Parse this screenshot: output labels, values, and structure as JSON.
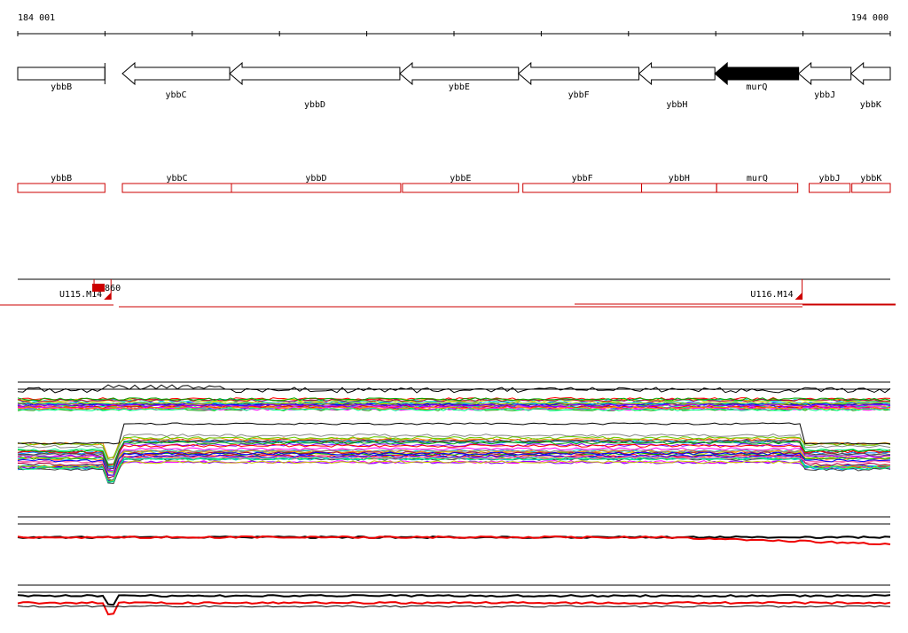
{
  "ruler": {
    "start_label": "184 001",
    "end_label": "194 000"
  },
  "genes": [
    {
      "name": "ybbB",
      "start": 184001,
      "end": 185000,
      "dir": "+",
      "filled": false,
      "label_row": 0
    },
    {
      "name": "ybbC",
      "start": 185200,
      "end": 186430,
      "dir": "-",
      "filled": false,
      "label_row": 1
    },
    {
      "name": "ybbD",
      "start": 186430,
      "end": 188380,
      "dir": "-",
      "filled": false,
      "label_row": 2
    },
    {
      "name": "ybbE",
      "start": 188380,
      "end": 189740,
      "dir": "-",
      "filled": false,
      "label_row": 0
    },
    {
      "name": "ybbF",
      "start": 189740,
      "end": 191120,
      "dir": "-",
      "filled": false,
      "label_row": 1
    },
    {
      "name": "ybbH",
      "start": 191120,
      "end": 191990,
      "dir": "-",
      "filled": false,
      "label_row": 2
    },
    {
      "name": "murQ",
      "start": 191990,
      "end": 192950,
      "dir": "-",
      "filled": true,
      "label_row": 0
    },
    {
      "name": "ybbJ",
      "start": 192950,
      "end": 193550,
      "dir": "-",
      "filled": false,
      "label_row": 1
    },
    {
      "name": "ybbK",
      "start": 193550,
      "end": 194000,
      "dir": "-",
      "filled": false,
      "label_row": 2
    }
  ],
  "gene_boxes": [
    {
      "name": "ybbB",
      "start": 184001,
      "end": 185000
    },
    {
      "name": "ybbC",
      "start": 185200,
      "end": 186450
    },
    {
      "name": "ybbD",
      "start": 186450,
      "end": 188390
    },
    {
      "name": "ybbE",
      "start": 188410,
      "end": 189740
    },
    {
      "name": "ybbF",
      "start": 189790,
      "end": 191150
    },
    {
      "name": "ybbH",
      "start": 191150,
      "end": 192010
    },
    {
      "name": "murQ",
      "start": 192010,
      "end": 192940
    },
    {
      "name": "ybbJ",
      "start": 193070,
      "end": 193540
    },
    {
      "name": "ybbK",
      "start": 193560,
      "end": 194000
    }
  ],
  "probes": [
    {
      "label": "U115.M14",
      "position": 185070
    },
    {
      "label": "U116.M14",
      "position": 192990
    }
  ],
  "probe_marker": {
    "label": "860",
    "position": 185160
  },
  "colors": {
    "gene_box": "#cc0000",
    "probe": "#cc0000",
    "track_line": "#000000",
    "filled_gene": "#000000"
  }
}
